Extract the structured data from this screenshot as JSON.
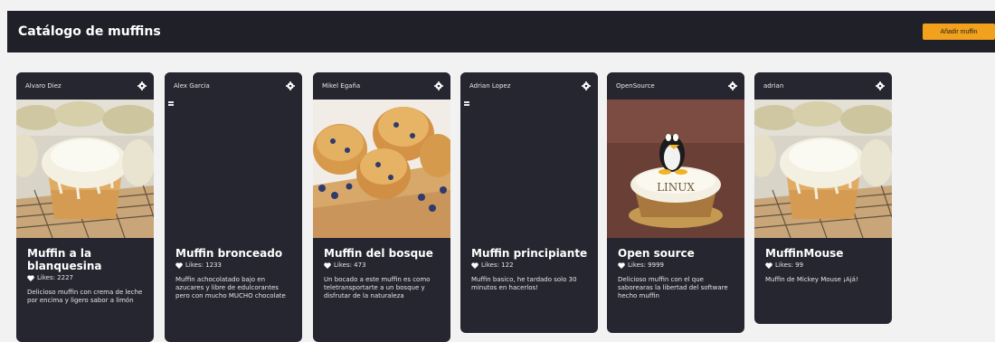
{
  "header": {
    "title": "Catálogo de muffins",
    "add_button": "Añadir muffin"
  },
  "icons": {
    "settings": "gear-icon",
    "likes": "heart-icon",
    "broken_image": "broken-image-icon"
  },
  "colors": {
    "header_bg": "#1f2028",
    "card_bg": "#25262f",
    "accent": "#f2a11c",
    "page_bg": "#f2f2f2"
  },
  "cards": [
    {
      "author": "Alvaro Diez",
      "title": "Muffin a la blanquesina",
      "likes": "Likes: 2227",
      "description": "Delicioso muffin con crema de leche por encima y ligero sabor a limón",
      "image": "lemon-glazed-muffins"
    },
    {
      "author": "Alex Garcia",
      "title": "Muffin bronceado",
      "likes": "Likes: 1233",
      "description": "Muffin achocolatado bajo en azucares y libre de edulcorantes pero con mucho MUCHO chocolate",
      "image": "broken"
    },
    {
      "author": "Mikel Egaña",
      "title": "Muffin del bosque",
      "likes": "Likes: 473",
      "description": "Un bocado a este muffin es como teletransportarte a un bosque y disfrutar de la naturaleza",
      "image": "blueberry-muffins"
    },
    {
      "author": "Adrian Lopez",
      "title": "Muffin principiante",
      "likes": "Likes: 122",
      "description": "Muffin basico, he tardado solo 30 minutos en hacerlos!",
      "image": "broken"
    },
    {
      "author": "OpenSource",
      "title": "Open source",
      "likes": "Likes: 9999",
      "description": "Delicioso muffin con el que saborearas la libertad del software hecho muffin",
      "image": "linux-cupcake",
      "image_text": "LINUX"
    },
    {
      "author": "adrian",
      "title": "MuffinMouse",
      "likes": "Likes: 99",
      "description": "Muffin de Mickey Mouse ¡Ajá!",
      "image": "lemon-glazed-muffins"
    }
  ]
}
